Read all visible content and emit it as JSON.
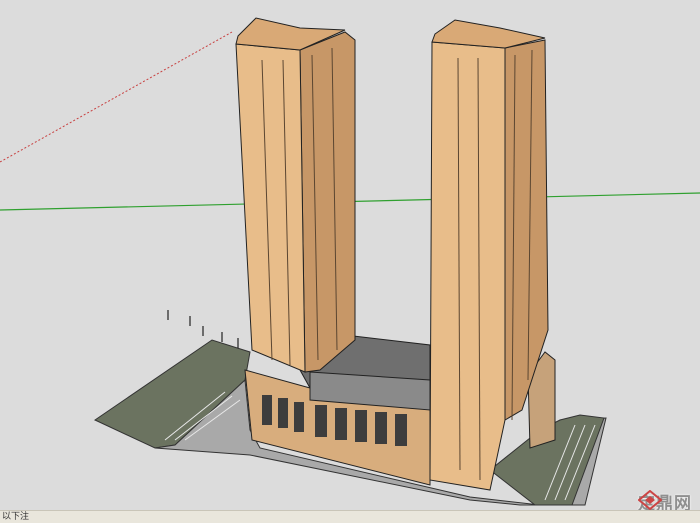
{
  "statusbar": {
    "text": "以下注"
  },
  "watermark": {
    "text": "定鼎网"
  },
  "colors": {
    "sky": "#dcdcdc",
    "facade": "#e8bd8a",
    "facade_shadow": "#c79767",
    "ground_green": "#6b7360",
    "road": "#a9a9a9",
    "green_axis": "#2fa02f",
    "red_axis": "#c84040"
  },
  "icons": [
    "watermark-logo-icon"
  ]
}
